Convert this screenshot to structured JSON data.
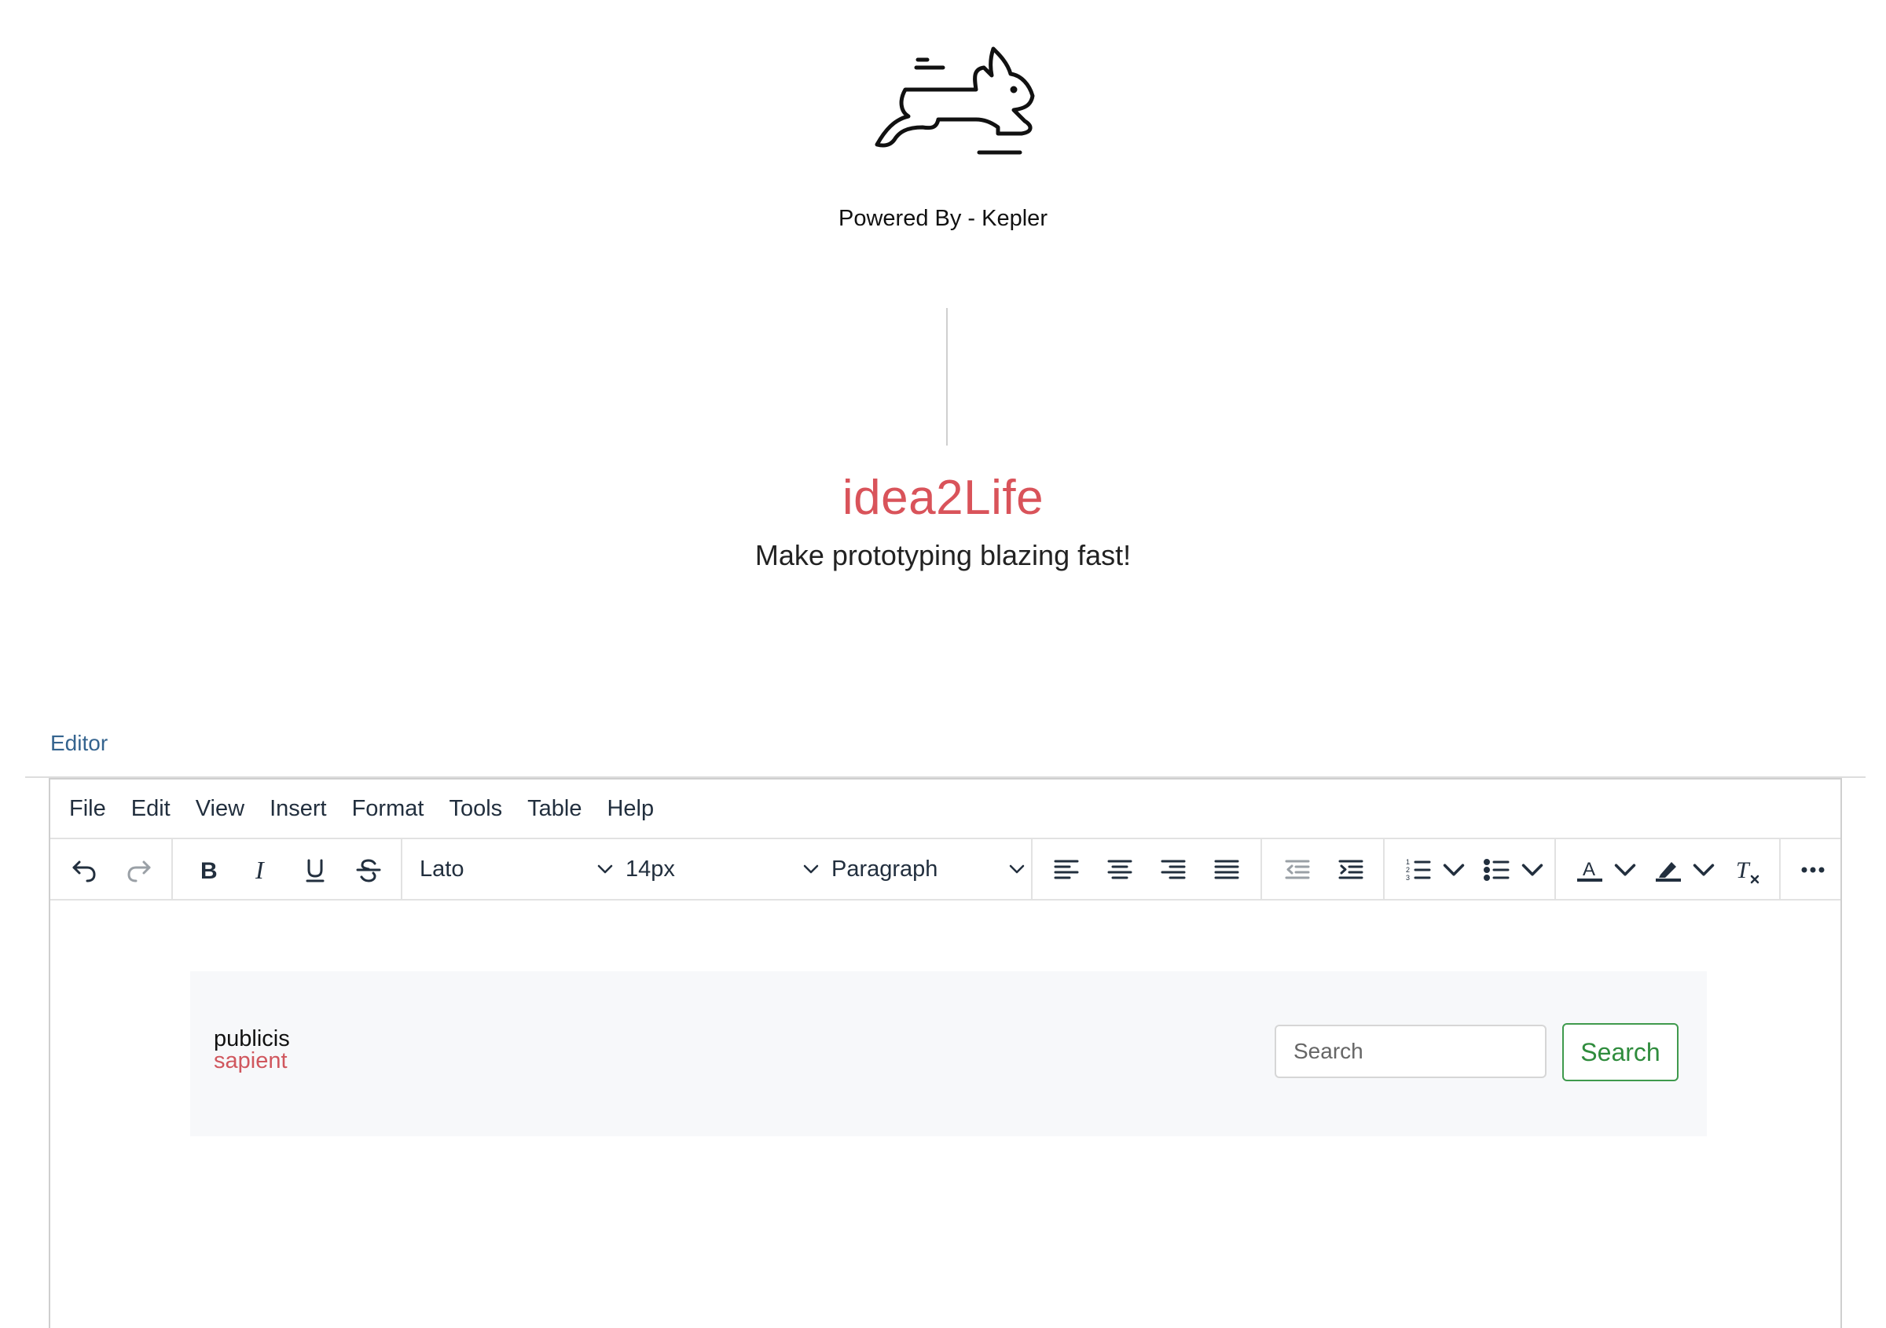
{
  "hero": {
    "powered_by": "Powered By - Kepler",
    "brand": "idea2Life",
    "tagline": "Make prototyping blazing fast!",
    "brand_color": "#d9535a",
    "logo_icon": "running-rabbit-icon"
  },
  "editor": {
    "label": "Editor",
    "menu": [
      "File",
      "Edit",
      "View",
      "Insert",
      "Format",
      "Tools",
      "Table",
      "Help"
    ],
    "toolbar": {
      "font_family": "Lato",
      "font_size": "14px",
      "block_format": "Paragraph",
      "buttons": [
        "undo-icon",
        "redo-icon",
        "bold-icon",
        "italic-icon",
        "underline-icon",
        "strikethrough-icon",
        "align-left-icon",
        "align-center-icon",
        "align-right-icon",
        "align-justify-icon",
        "outdent-icon",
        "indent-icon",
        "numbered-list-icon",
        "bullet-list-icon",
        "text-color-icon",
        "highlight-color-icon",
        "clear-formatting-icon",
        "more-icon"
      ]
    },
    "content": {
      "logo_line1": "publicis",
      "logo_line2": "sapient",
      "search_placeholder": "Search",
      "search_button": "Search",
      "search_button_color": "#2f8c3d"
    }
  }
}
